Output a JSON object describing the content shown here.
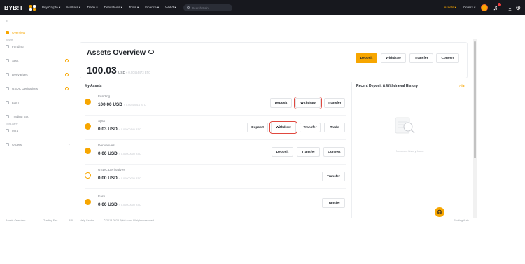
{
  "nav": {
    "logo": "BYB!T",
    "items": [
      "Buy Crypto ▾",
      "Markets ▾",
      "Trade ▾",
      "Derivatives ▾",
      "Tools ▾",
      "Finance ▾",
      "Web3 ▾"
    ],
    "search_placeholder": "Search Coin",
    "assets_label": "Assets ▾",
    "orders_label": "Orders ▾"
  },
  "sidebar": {
    "top_label": "≡",
    "items": [
      {
        "label": "Overview",
        "active": true
      },
      {
        "label": "Funding"
      },
      {
        "label": "Spot"
      },
      {
        "label": "Derivatives"
      },
      {
        "label": "USDC Derivatives"
      },
      {
        "label": "Earn"
      },
      {
        "label": "Trading Bot"
      },
      {
        "label": "MT4"
      },
      {
        "label": "Orders"
      }
    ],
    "sub_assets": "Assets",
    "sub_third_party": "Third-party"
  },
  "overview": {
    "title": "Assets Overview",
    "amount": "100.03",
    "unit": "USD",
    "btc": "≈ 0.00464473 BTC",
    "buttons": {
      "deposit": "Deposit",
      "withdraw": "Withdraw",
      "transfer": "Transfer",
      "convert": "Convert"
    }
  },
  "my_assets": {
    "title": "My Assets",
    "rows": [
      {
        "name": "Funding",
        "value": "100.00 USD",
        "btc": "≈ 0.00464014 BTC",
        "buttons": [
          "Deposit",
          "Withdraw",
          "Transfer"
        ]
      },
      {
        "name": "Spot",
        "value": "0.03 USD",
        "btc": "≈ 0.00000140 BTC",
        "buttons": [
          "Deposit",
          "Withdraw",
          "Transfer",
          "Trade"
        ]
      },
      {
        "name": "Derivatives",
        "value": "0.00 USD",
        "btc": "≈ 0.00000000 BTC",
        "buttons": [
          "Deposit",
          "Transfer",
          "Convert"
        ]
      },
      {
        "name": "USDC Derivatives",
        "value": "0.00 USD",
        "btc": "≈ 0.00000000 BTC",
        "buttons": [
          "Transfer"
        ]
      },
      {
        "name": "Earn",
        "value": "0.00 USD",
        "btc": "≈ 0.00000000 BTC",
        "buttons": [
          "Transfer"
        ]
      }
    ]
  },
  "history": {
    "title": "Recent Deposit & Withdrawal History",
    "all_link": "All ▸",
    "empty_text": "No recent history found."
  },
  "footer": {
    "links": [
      "Assets Overview",
      "Trading Fee",
      "API",
      "Help Center"
    ],
    "copyright": "© 2018-2023 Bybit.com. All rights reserved.",
    "right": "Routing Auto"
  },
  "colors": {
    "accent": "#f7a600",
    "nav_bg": "#17181e",
    "highlight": "#e0483f"
  }
}
